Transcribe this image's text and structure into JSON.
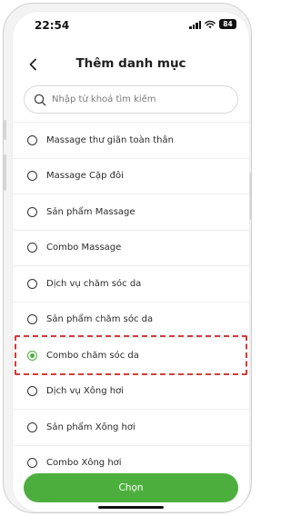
{
  "status_bar": {
    "time": "22:54",
    "battery": "84"
  },
  "header": {
    "title": "Thêm danh mục"
  },
  "search": {
    "placeholder": "Nhập từ khoá tìm kiếm",
    "value": ""
  },
  "categories": [
    {
      "label": "Massage thư giãn toàn thân",
      "selected": false
    },
    {
      "label": "Massage Cặp đôi",
      "selected": false
    },
    {
      "label": "Sản phẩm Massage",
      "selected": false
    },
    {
      "label": "Combo Massage",
      "selected": false
    },
    {
      "label": "Dịch vụ chăm sóc da",
      "selected": false
    },
    {
      "label": "Sản phẩm chăm sóc da",
      "selected": false
    },
    {
      "label": "Combo chăm sóc da",
      "selected": true
    },
    {
      "label": "Dịch vụ Xông hơi",
      "selected": false
    },
    {
      "label": "Sản phẩm Xông hơi",
      "selected": false
    },
    {
      "label": "Combo Xông hơi",
      "selected": false
    }
  ],
  "footer": {
    "confirm_label": "Chọn"
  },
  "colors": {
    "accent": "#4caf3d",
    "highlight": "#d23b3b"
  }
}
